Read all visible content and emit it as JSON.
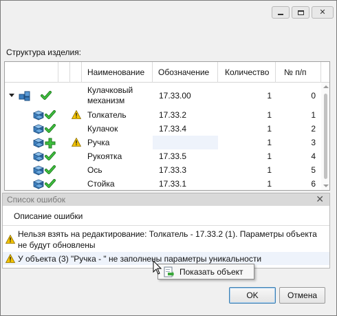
{
  "window": {
    "controls": [
      "minimize-icon",
      "maximize-icon",
      "close-icon"
    ],
    "close_glyph": "✕"
  },
  "structure": {
    "label": "Структура изделия:",
    "columns": {
      "name": "Наименование",
      "designation": "Обозначение",
      "quantity": "Количество",
      "index": "№ п/п"
    },
    "rows": [
      {
        "name": "Кулачковый механизм",
        "designation": "17.33.00",
        "quantity": "1",
        "index": "0",
        "icon": "assembly-icon",
        "status": "check-icon",
        "warning": false,
        "level": 0,
        "expanded": true
      },
      {
        "name": "Толкатель",
        "designation": "17.33.2",
        "quantity": "1",
        "index": "1",
        "icon": "part-icon",
        "status": "check-icon",
        "warning": true,
        "level": 1
      },
      {
        "name": "Кулачок",
        "designation": "17.33.4",
        "quantity": "1",
        "index": "2",
        "icon": "part-icon",
        "status": "check-icon",
        "warning": false,
        "level": 1
      },
      {
        "name": "Ручка",
        "designation": "",
        "quantity": "1",
        "index": "3",
        "icon": "part-icon",
        "status": "plus-icon",
        "warning": true,
        "level": 1,
        "selected": true
      },
      {
        "name": "Рукоятка",
        "designation": "17.33.5",
        "quantity": "1",
        "index": "4",
        "icon": "part-icon",
        "status": "check-icon",
        "warning": false,
        "level": 1
      },
      {
        "name": "Ось",
        "designation": "17.33.3",
        "quantity": "1",
        "index": "5",
        "icon": "part-icon",
        "status": "check-icon",
        "warning": false,
        "level": 1
      },
      {
        "name": "Стойка",
        "designation": "17.33.1",
        "quantity": "1",
        "index": "6",
        "icon": "part-icon",
        "status": "check-icon",
        "warning": false,
        "level": 1
      }
    ]
  },
  "errors": {
    "title": "Список ошибок",
    "close_glyph": "✕",
    "column": "Описание ошибки",
    "items": [
      {
        "text": "Нельзя взять на редактирование: Толкатель - 17.33.2 (1). Параметры объекта не будут обновлены"
      },
      {
        "text": "У объекта (3) \"Ручка - \" не заполнены параметры уникальности"
      }
    ]
  },
  "context_menu": {
    "items": [
      {
        "label": "Показать объект",
        "icon": "show-object-icon"
      }
    ]
  },
  "buttons": {
    "ok": "OK",
    "cancel": "Отмена"
  },
  "colors": {
    "check": "#2f9e2f",
    "warning": "#f3c300",
    "part": "#3d7fbf",
    "selection": "#eef3fb",
    "ok_border": "#3c7fb1"
  }
}
